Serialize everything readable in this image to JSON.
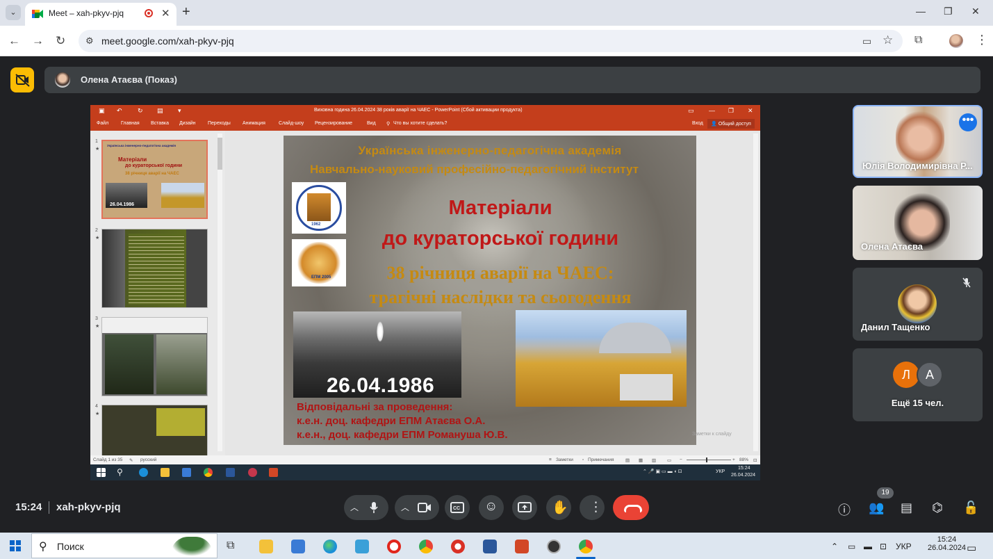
{
  "browser": {
    "tab_title": "Meet – xah-pkyv-pjq",
    "tab_close": "✕",
    "new_tab": "+",
    "url": "meet.google.com/xah-pkyv-pjq",
    "window_min": "—",
    "window_max": "❐",
    "window_close": "✕"
  },
  "meet": {
    "presenter_label": "Олена Атаєва (Показ)",
    "clock": "15:24",
    "meeting_code": "xah-pkyv-pjq",
    "participant_count": "19",
    "accent_color": "#8ab4f8",
    "hangup_color": "#ea4335"
  },
  "participants": [
    {
      "name": "Юлія Володимирівна Р..."
    },
    {
      "name": "Олена Атаєва"
    },
    {
      "name": "Данил Тащенко"
    },
    {
      "name": "Ещё 15 чел.",
      "avatars": [
        "Л",
        "А"
      ]
    }
  ],
  "powerpoint": {
    "window_title": "Виховна година 26.04.2024 38 років аварії на ЧАЕС - PowerPoint (Сбой активации продукта)",
    "tabs": [
      "Файл",
      "Главная",
      "Вставка",
      "Дизайн",
      "Переходы",
      "Анимация",
      "Слайд-шоу",
      "Рецензирование",
      "Вид"
    ],
    "tell_me": "Что вы хотите сделать?",
    "signin": "Вход",
    "share": "Общий доступ",
    "thumb_numbers": [
      "1",
      "2",
      "3",
      "4"
    ],
    "thumb1": {
      "l1": "Українська інженерно-педагогічна академія",
      "l2": "Матеріали",
      "l3": "до кураторської години",
      "l4": "38 річниця аварії на ЧАЕС",
      "date": "26.04.1986"
    },
    "notes_hint": "Заметки к слайду",
    "status_slide": "Слайд 1 из 35",
    "status_lang": "русский",
    "status_notes": "Заметки",
    "status_comments": "Примечания",
    "status_zoom": "88%",
    "taskbar_time": "15:24",
    "taskbar_date": "26.04.2024",
    "taskbar_lang": "УКР"
  },
  "slide": {
    "line1": "Українська інженерно-педагогічна академія",
    "line2": "Навчально-науковий професійно-педагогічний інститут",
    "title1": "Матеріали",
    "title2": "до кураторської години",
    "subtitle1": "38 річниця аварії на ЧАЕС:",
    "subtitle2": "трагічні наслідки та сьогодення",
    "logo1_year": "1962",
    "logo2_text": "ЕПМ 2005",
    "date": "26.04.1986",
    "resp1": "Відповідальні за проведення:",
    "resp2": "к.е.н. доц. кафедри ЕПМ Атаєва О.А.",
    "resp3": "к.е.н., доц. кафедри ЕПМ Романуша Ю.В."
  },
  "windows": {
    "search_placeholder": "Поиск",
    "lang": "УКР",
    "time": "15:24",
    "date": "26.04.2024"
  }
}
